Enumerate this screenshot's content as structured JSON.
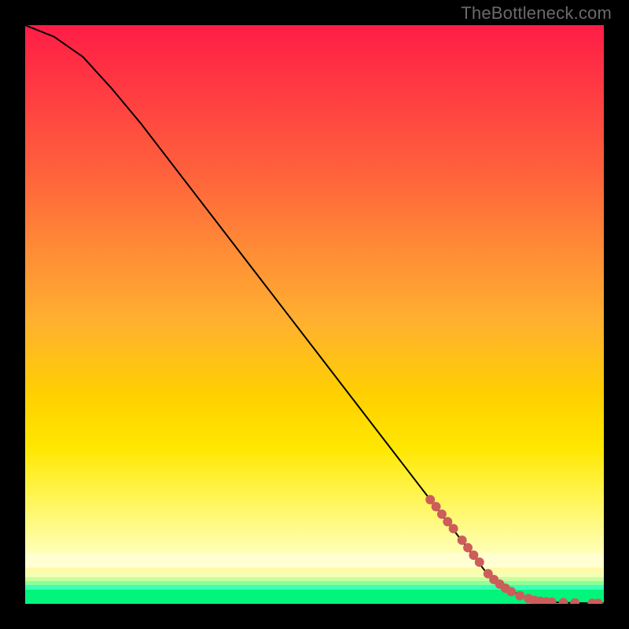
{
  "watermark": "TheBottleneck.com",
  "chart_data": {
    "type": "line",
    "title": "",
    "xlabel": "",
    "ylabel": "",
    "xlim": [
      0,
      100
    ],
    "ylim": [
      0,
      100
    ],
    "grid": false,
    "series": [
      {
        "name": "curve",
        "x": [
          0,
          5,
          10,
          15,
          20,
          25,
          30,
          35,
          40,
          45,
          50,
          55,
          60,
          65,
          70,
          75,
          80,
          82,
          84,
          86,
          88,
          90,
          92,
          94,
          96,
          98,
          100
        ],
        "y": [
          100,
          98,
          94.5,
          89,
          83,
          76.5,
          70,
          63.5,
          57,
          50.5,
          44,
          37.5,
          31,
          24.5,
          18,
          11.5,
          5,
          3.5,
          2.2,
          1.3,
          0.7,
          0.4,
          0.25,
          0.18,
          0.13,
          0.1,
          0.08
        ]
      }
    ],
    "markers": {
      "name": "highlighted-points",
      "color": "#cc5d5a",
      "points": [
        {
          "x": 70,
          "y": 18
        },
        {
          "x": 71,
          "y": 16.8
        },
        {
          "x": 72,
          "y": 15.5
        },
        {
          "x": 73,
          "y": 14.2
        },
        {
          "x": 74,
          "y": 13
        },
        {
          "x": 75.5,
          "y": 11
        },
        {
          "x": 76.5,
          "y": 9.7
        },
        {
          "x": 77.5,
          "y": 8.4
        },
        {
          "x": 78.5,
          "y": 7.2
        },
        {
          "x": 80,
          "y": 5.2
        },
        {
          "x": 81,
          "y": 4.2
        },
        {
          "x": 82,
          "y": 3.4
        },
        {
          "x": 83,
          "y": 2.7
        },
        {
          "x": 84,
          "y": 2.1
        },
        {
          "x": 85.5,
          "y": 1.4
        },
        {
          "x": 87,
          "y": 0.9
        },
        {
          "x": 88,
          "y": 0.6
        },
        {
          "x": 89,
          "y": 0.45
        },
        {
          "x": 90,
          "y": 0.35
        },
        {
          "x": 91,
          "y": 0.3
        },
        {
          "x": 93,
          "y": 0.22
        },
        {
          "x": 95,
          "y": 0.16
        },
        {
          "x": 98,
          "y": 0.1
        },
        {
          "x": 99,
          "y": 0.09
        }
      ]
    },
    "background_bands": [
      {
        "name": "red-orange-yellow-gradient",
        "from_y": 9,
        "to_y": 100
      },
      {
        "name": "pale-yellow",
        "from_y": 7,
        "to_y": 9
      },
      {
        "name": "cream-to-lightgreen",
        "from_y": 3,
        "to_y": 7
      },
      {
        "name": "bright-green",
        "from_y": 0,
        "to_y": 3
      }
    ]
  }
}
